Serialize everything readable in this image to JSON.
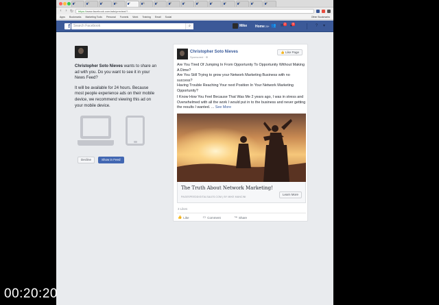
{
  "browser": {
    "tabs": [
      "F",
      "T",
      "F",
      "D",
      "F",
      "G",
      "F",
      "F",
      "F",
      "F",
      "F",
      "F",
      "F",
      "F",
      "F"
    ],
    "url_scheme": "https://",
    "url": "www.facebook.com/ads/preview/?...",
    "bookmarks": [
      "Apps",
      "Bookmarks",
      "Marketing Tools",
      "Personal",
      "Funnels",
      "Work",
      "Training",
      "Email",
      "Social",
      "Other Bookmarks"
    ]
  },
  "header": {
    "logo": "f",
    "search_placeholder": "Search Facebook",
    "user_name": "Mike",
    "home_label": "Home",
    "home_count": "20+",
    "friend_badge": "2",
    "notif_badge": "9"
  },
  "preview": {
    "advertiser": "Christopher Soto Nieves",
    "share_text_rest": " wants to share an ad with you. Do you want to see it in your News Feed?",
    "availability_text": "It will be available for 24 hours. Because most people experience ads on their mobile device, we recommend viewing this ad on your mobile device.",
    "decline_label": "Decline",
    "show_label": "Show in Feed"
  },
  "ad": {
    "page_name": "Christopher Soto Nieves",
    "sponsored": "Sponsored · ⊕",
    "like_page": "Like Page",
    "lines": [
      "Are You Tired Of Jumping In From Opportunity To Opportunity Without Making A Dime?",
      "Are You Still Trying to grow your Network Marketing Business with no success?",
      "Having Trouble Reaching Your next Position In Your Network Marketing Opportunity?",
      "I Know How You Feel Because That Was Me 2 years ago, I was in stress and Overwhelmed with all the work I would put in to the business and never getting the results I wanted. ..."
    ],
    "see_more": "See More",
    "link_title": "The Truth About Network Marketing!",
    "link_caption": "PAGESPEEDDIGITALSALES.COM | BY MIKE MANCINI",
    "learn_more": "Learn More",
    "likes_count": "3 Likes",
    "actions": [
      "Like",
      "Comment",
      "Share"
    ]
  },
  "overlay": {
    "timestamp": "00:20:20"
  },
  "colors": {
    "facebook_blue": "#3b5998",
    "button_blue": "#4267b2",
    "link_blue": "#365899",
    "page_bg": "#e9ebee"
  }
}
